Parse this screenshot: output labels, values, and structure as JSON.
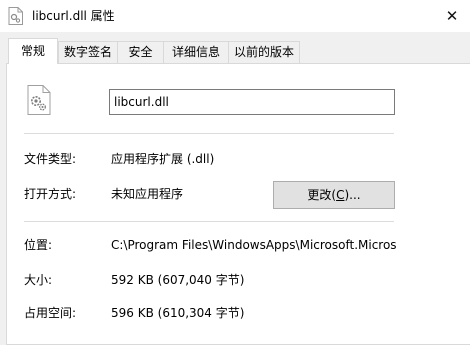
{
  "window": {
    "title": "libcurl.dll 属性",
    "close_label": "✕"
  },
  "tabs": [
    {
      "label": "常规"
    },
    {
      "label": "数字签名"
    },
    {
      "label": "安全"
    },
    {
      "label": "详细信息"
    },
    {
      "label": "以前的版本"
    }
  ],
  "file": {
    "name": "libcurl.dll",
    "icon": "dll-gear-icon"
  },
  "props": {
    "type_label": "文件类型:",
    "type_value": "应用程序扩展 (.dll)",
    "open_label": "打开方式:",
    "open_value": "未知应用程序",
    "change_pre": "更改(",
    "change_key": "C",
    "change_post": ")...",
    "location_label": "位置:",
    "location_value": "C:\\Program Files\\WindowsApps\\Microsoft.Micros",
    "size_label": "大小:",
    "size_value": "592 KB (607,040 字节)",
    "disk_label": "占用空间:",
    "disk_value": "596 KB (610,304 字节)"
  }
}
